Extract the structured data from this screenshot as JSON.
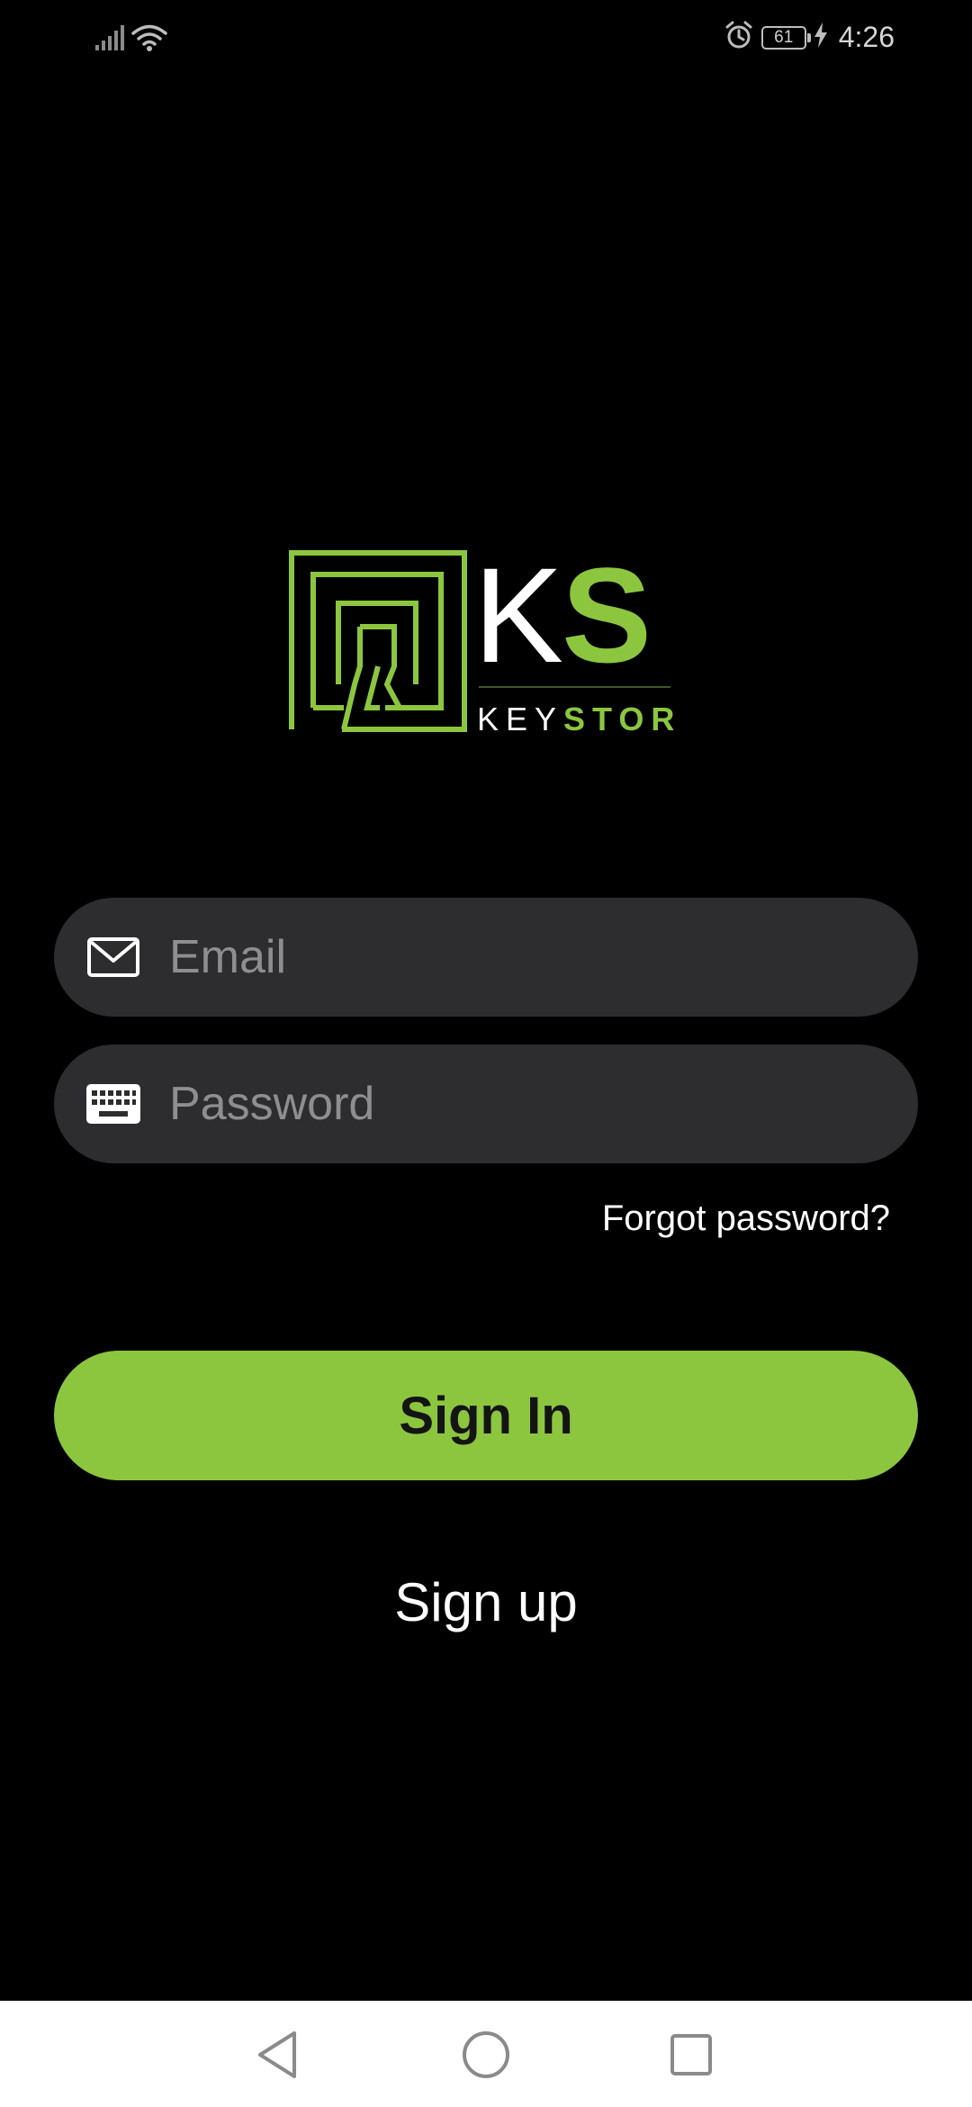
{
  "status_bar": {
    "icons": [
      "cell-signal-icon",
      "wifi-icon",
      "alarm-icon",
      "battery-icon",
      "charging-icon"
    ],
    "battery_level": "61",
    "time": "4:26"
  },
  "logo": {
    "monogram_k": "K",
    "monogram_s": "S",
    "wordmark_key": "KEY",
    "wordmark_stor": "STOR"
  },
  "form": {
    "email": {
      "icon": "mail-icon",
      "placeholder": "Email",
      "value": ""
    },
    "password": {
      "icon": "keyboard-icon",
      "placeholder": "Password",
      "value": ""
    },
    "forgot_label": "Forgot password?",
    "signin_label": "Sign In",
    "signup_label": "Sign up"
  },
  "nav_bar": {
    "icons": [
      "back-icon",
      "home-icon",
      "recents-icon"
    ]
  },
  "colors": {
    "background": "#000000",
    "accent": "#8cc63f",
    "field_bg": "#2d2d2f",
    "placeholder": "#8e8e91"
  }
}
